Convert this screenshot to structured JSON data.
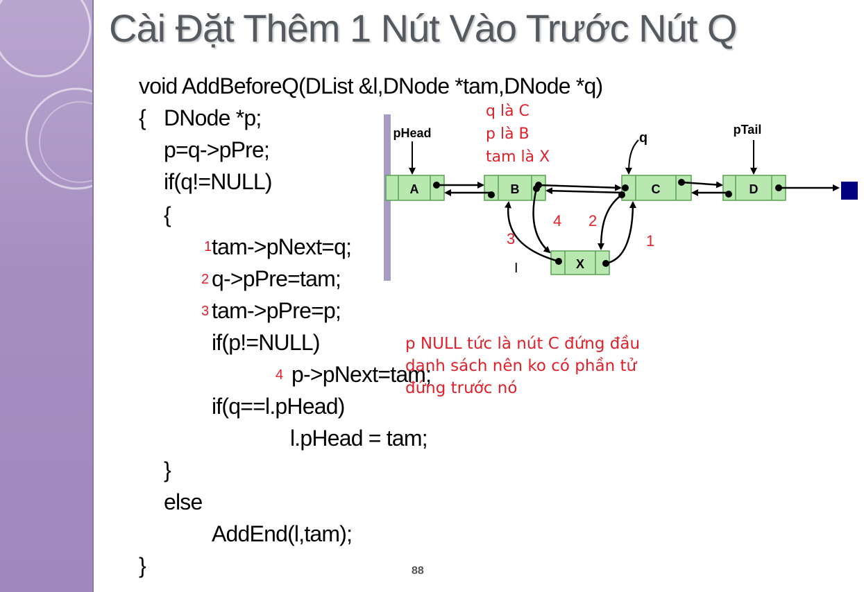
{
  "slide": {
    "title": "Cài Đặt Thêm 1 Nút Vào Trước Nút Q",
    "page_number": "88"
  },
  "code": {
    "line1": "void AddBeforeQ(DList &l,DNode *tam,DNode *q)",
    "line2_brace": "{",
    "line2": "DNode *p;",
    "line3": "p=q->pPre;",
    "line4": "if(q!=NULL)",
    "line5": "{",
    "line6": "tam->pNext=q;",
    "line7": "q->pPre=tam;",
    "line8": "tam->pPre=p;",
    "line9": "if(p!=NULL)",
    "line10": "p->pNext=tam;",
    "line11": "if(q==l.pHead)",
    "line12": "l.pHead = tam;",
    "line13": "}",
    "line14": "else",
    "line15": "AddEnd(l,tam);",
    "line16": "}"
  },
  "step_markers": {
    "s1": "1",
    "s2": "2",
    "s3": "3",
    "s4": "4"
  },
  "annotations": {
    "q_is": "q là C",
    "p_is": "p là B",
    "tam_is": "tam là X",
    "note_line1": "p NULL tức là nút C đứng đầu",
    "note_line2": "danh sách nên ko có phần tử",
    "note_line3": "đứng trước nó"
  },
  "diagram": {
    "nodes": {
      "a": "A",
      "b": "B",
      "c": "C",
      "d": "D",
      "x": "X"
    },
    "pointers": {
      "head": "pHead",
      "tail": "pTail",
      "q": "q"
    },
    "arrow_numbers": {
      "n1": "1",
      "n2": "2",
      "n3": "3",
      "n4": "4"
    }
  },
  "colors": {
    "node_fill": "#b8e8b0",
    "node_border": "#5aa050",
    "accent_red": "#e0202a",
    "sidebar": "#a58fc0"
  }
}
